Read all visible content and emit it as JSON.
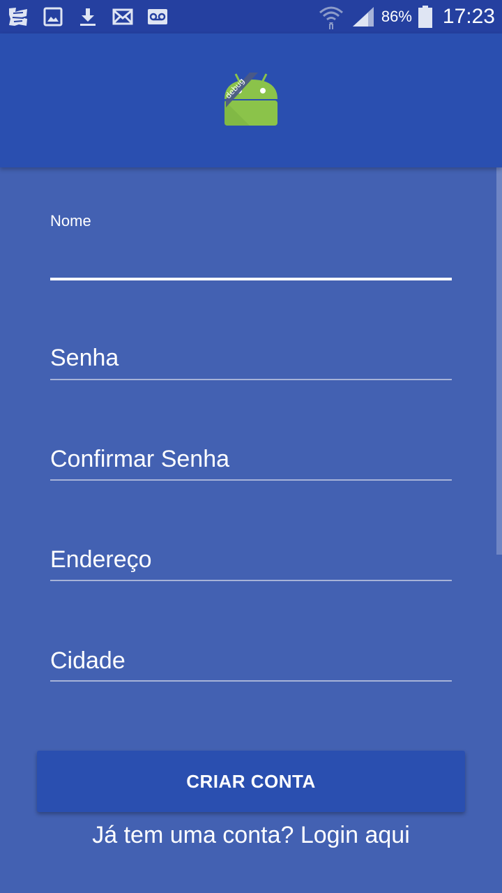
{
  "status_bar": {
    "battery_percent": "86%",
    "time": "17:23",
    "icons": [
      "app-notification-icon",
      "image-icon",
      "download-icon",
      "mail-icon",
      "voicemail-icon",
      "wifi-icon",
      "signal-icon",
      "battery-icon"
    ]
  },
  "header": {
    "logo_badge": "debug"
  },
  "form": {
    "fields": [
      {
        "label": "Nome"
      },
      {
        "label": "Senha"
      },
      {
        "label": "Confirmar Senha"
      },
      {
        "label": "Endereço"
      },
      {
        "label": "Cidade"
      }
    ]
  },
  "actions": {
    "create_account_label": "CRIAR CONTA",
    "login_prompt": "Já tem uma conta? Login aqui"
  },
  "colors": {
    "background": "#4361b2",
    "primary": "#2a4fb0",
    "status_bar": "#2540a0",
    "android_green": "#8bc34a"
  }
}
